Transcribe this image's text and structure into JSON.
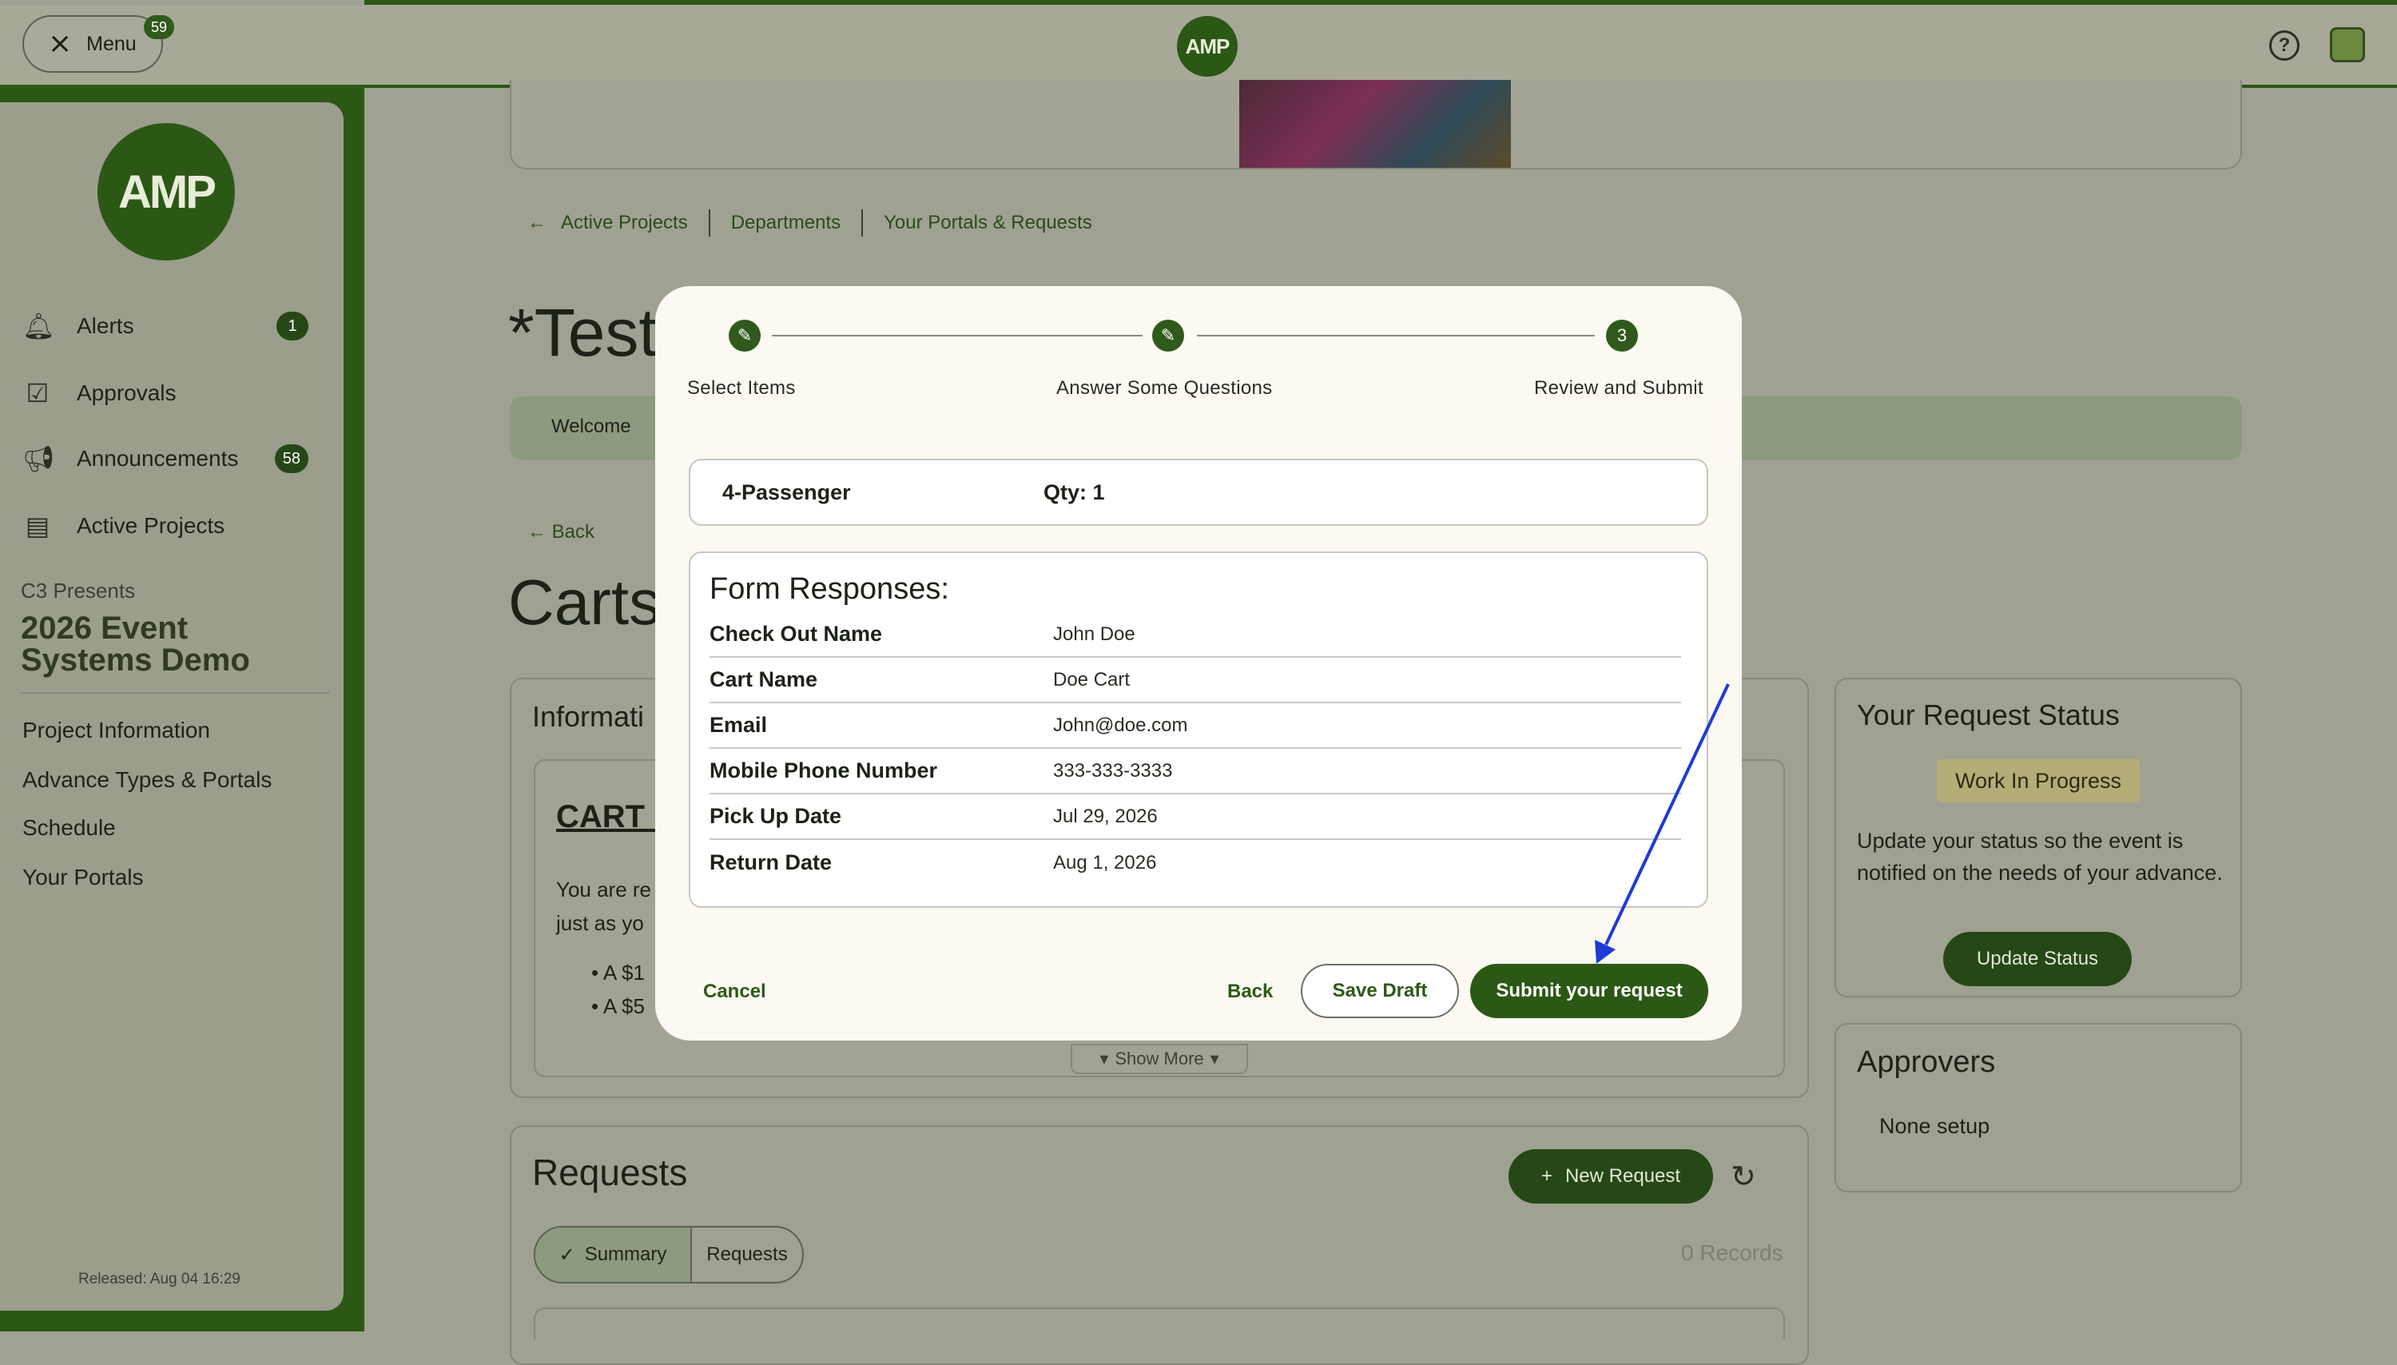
{
  "topbar": {
    "menu_label": "Menu",
    "menu_badge": "59",
    "logo_text": "AMP"
  },
  "sidebar": {
    "logo_text": "AMP",
    "nav": [
      {
        "label": "Alerts",
        "badge": "1",
        "icon": "bell-icon"
      },
      {
        "label": "Approvals",
        "badge": "",
        "icon": "clipboard-check-icon"
      },
      {
        "label": "Announcements",
        "badge": "58",
        "icon": "megaphone-icon"
      },
      {
        "label": "Active Projects",
        "badge": "",
        "icon": "projects-icon"
      }
    ],
    "org": "C3 Presents",
    "project": "2026 Event Systems Demo",
    "links": [
      "Project Information",
      "Advance Types & Portals",
      "Schedule",
      "Your Portals"
    ],
    "released": "Released: Aug 04 16:29"
  },
  "breadcrumbs": [
    "Active Projects",
    "Departments",
    "Your Portals & Requests"
  ],
  "page": {
    "title": "*Test",
    "welcome_tab": "Welcome",
    "back_label": "Back",
    "carts_title": "Carts",
    "info_title": "Informati",
    "cart_heading": "CART I",
    "cart_text_1": "You are re",
    "cart_text_2": "just as yo",
    "bullet_1": "A $1",
    "bullet_2": "A $5",
    "show_more": "Show More"
  },
  "status_panel": {
    "title": "Your Request Status",
    "status": "Work In Progress",
    "text": "Update your status so the event is notified on the needs of your advance.",
    "button": "Update Status"
  },
  "approvers": {
    "title": "Approvers",
    "none": "None setup"
  },
  "requests": {
    "title": "Requests",
    "new_request": "New Request",
    "tab_summary": "Summary",
    "tab_requests": "Requests",
    "records": "0 Records"
  },
  "modal": {
    "steps": [
      {
        "label": "Select Items",
        "marker": "✎"
      },
      {
        "label": "Answer Some Questions",
        "marker": "✎"
      },
      {
        "label": "Review and Submit",
        "marker": "3"
      }
    ],
    "item": {
      "name": "4-Passenger",
      "qty": "Qty: 1"
    },
    "form_heading": "Form Responses:",
    "responses": [
      {
        "k": "Check Out Name",
        "v": "John Doe"
      },
      {
        "k": "Cart Name",
        "v": "Doe Cart"
      },
      {
        "k": "Email",
        "v": "John@doe.com"
      },
      {
        "k": "Mobile Phone Number",
        "v": "333-333-3333"
      },
      {
        "k": "Pick Up Date",
        "v": "Jul 29, 2026"
      },
      {
        "k": "Return Date",
        "v": "Aug 1, 2026"
      }
    ],
    "cancel": "Cancel",
    "back": "Back",
    "save_draft": "Save Draft",
    "submit": "Submit your request"
  },
  "colors": {
    "brand_green": "#2c5816",
    "annotation_arrow": "#1f3bd6"
  }
}
